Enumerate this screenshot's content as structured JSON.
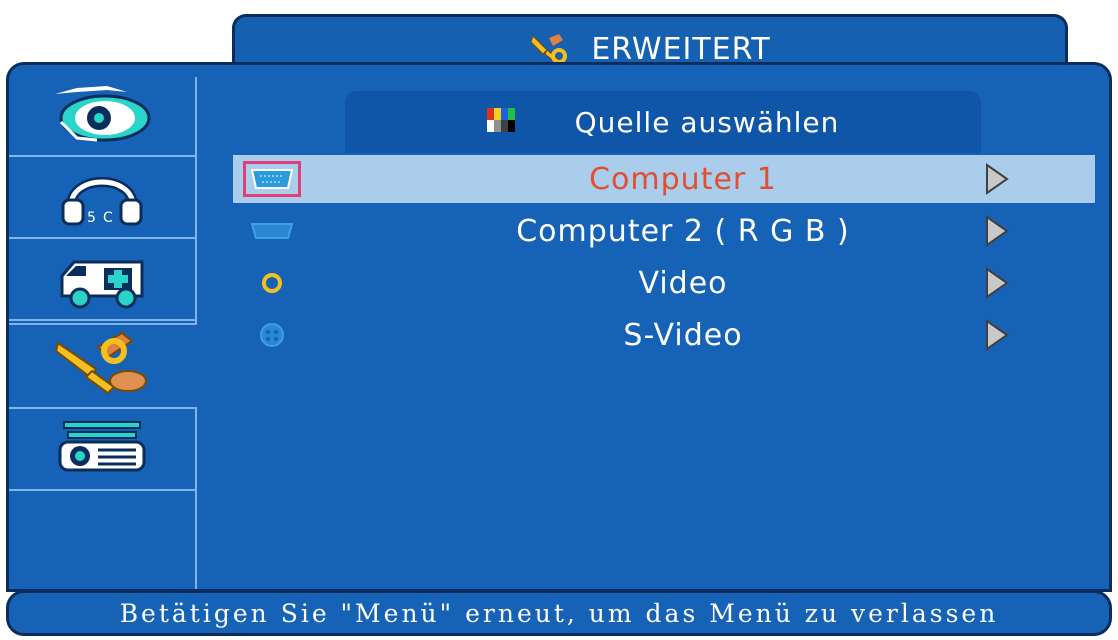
{
  "header": {
    "title": "ERWEITERT",
    "icon": "tools-icon"
  },
  "sidebar": {
    "items": [
      {
        "name": "picture-eye-icon",
        "active": false
      },
      {
        "name": "audio-headphones-icon",
        "active": false
      },
      {
        "name": "setup-ambulance-icon",
        "active": false
      },
      {
        "name": "tools-icon",
        "active": true
      },
      {
        "name": "projector-icon",
        "active": false
      }
    ]
  },
  "submenu": {
    "title": "Quelle auswählen",
    "icon": "color-bars-icon",
    "items": [
      {
        "label": "Computer 1",
        "icon": "vga-port-icon",
        "selected": true
      },
      {
        "label": "Computer 2 ( R G B )",
        "icon": "vga-port-icon",
        "selected": false
      },
      {
        "label": "Video",
        "icon": "rca-port-icon",
        "selected": false
      },
      {
        "label": "S-Video",
        "icon": "svideo-port-icon",
        "selected": false
      }
    ]
  },
  "footer": {
    "text": "Betätigen Sie \"Menü\" erneut, um das Menü zu verlassen"
  },
  "colors": {
    "panel": "#1662b6",
    "border": "#0a2d5c",
    "selected_row": "#a9cdea",
    "selected_text": "#e05030",
    "focus_frame": "#e0407a",
    "icon_yellow": "#f2c020"
  }
}
